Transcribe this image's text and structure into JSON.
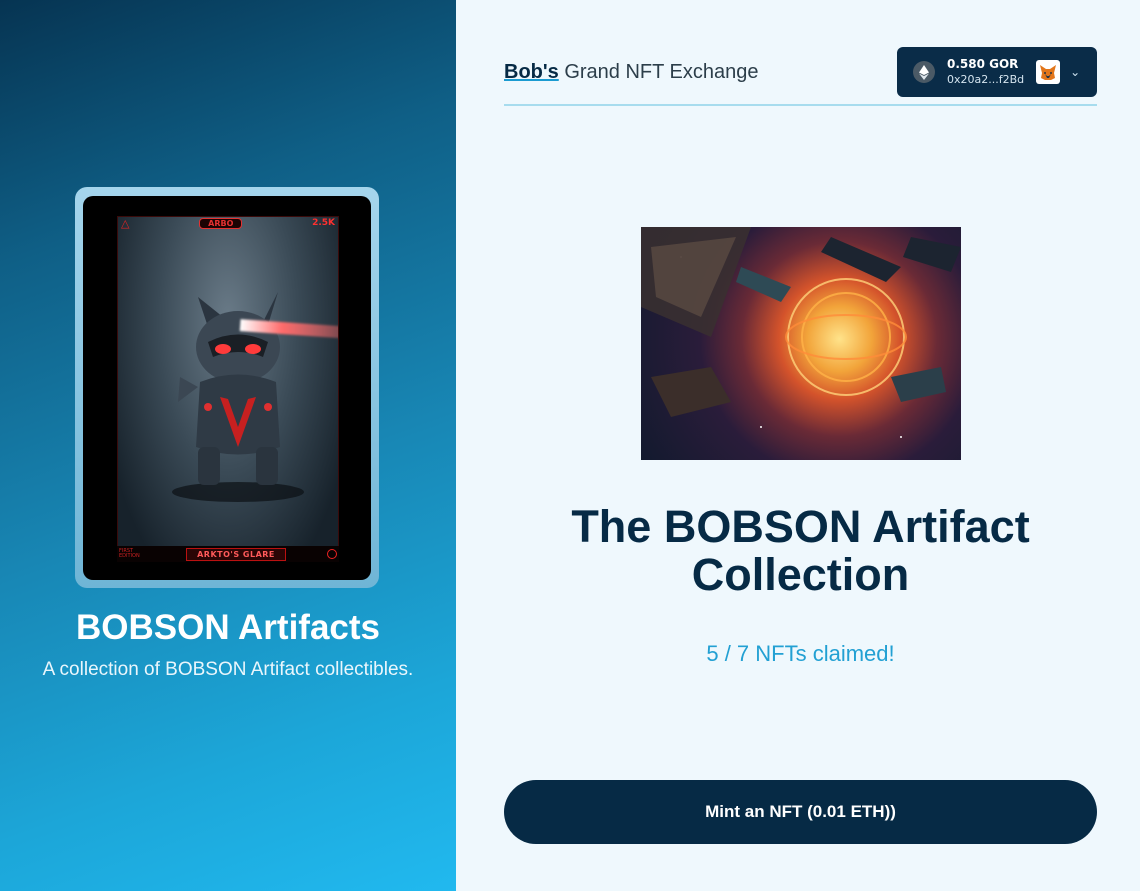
{
  "collection": {
    "title": "BOBSON Artifacts",
    "description": "A collection of BOBSON Artifact collectibles.",
    "card": {
      "badge": "ARBO",
      "count": "2.5K",
      "edition": "FIRST EDITION",
      "name": "ARKTO'S GLARE"
    }
  },
  "header": {
    "brand_bold": "Bob's",
    "brand_rest": " Grand NFT Exchange",
    "wallet": {
      "balance": "0.580 GOR",
      "address": "0x20a2...f2Bd",
      "icons": [
        "ethereum-icon",
        "metamask-fox-icon",
        "chevron-down-icon"
      ]
    }
  },
  "main": {
    "title": "The BOBSON Artifact Collection",
    "claimed_text": "5 / 7 NFTs claimed!",
    "claimed": 5,
    "total": 7,
    "mint_label": "Mint an NFT (0.01 ETH))"
  },
  "colors": {
    "primary": "#062a45",
    "accent": "#22a0d3",
    "background": "#eff8fd"
  }
}
